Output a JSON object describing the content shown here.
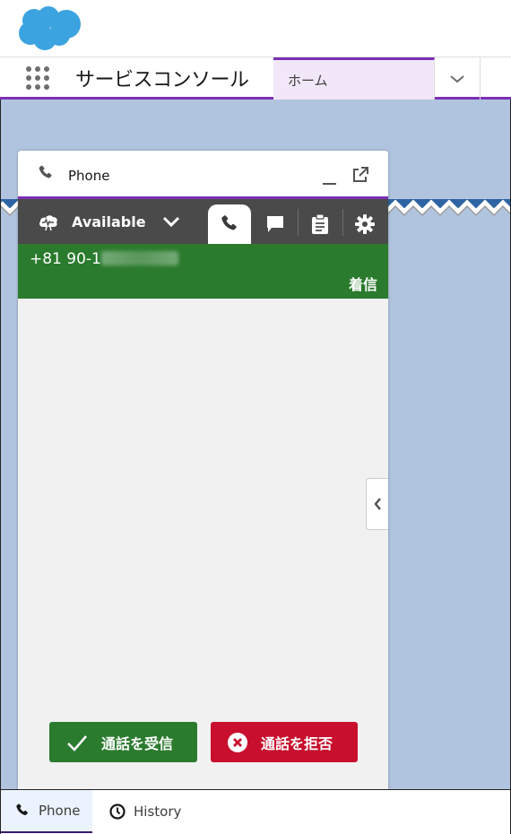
{
  "header": {
    "logo": "salesforce-cloud-logo",
    "app_launcher_icon": "app-launcher-grid-icon",
    "app_name": "サービスコンソール",
    "nav_tabs": [
      {
        "label": "ホーム",
        "active": true
      }
    ],
    "nav_more_icon": "chevron-down-icon"
  },
  "phone_panel": {
    "title": "Phone",
    "title_icon": "phone-icon",
    "minimize_icon": "minimize-icon",
    "popout_icon": "popout-icon",
    "toolbar": {
      "status_label": "Available",
      "status_icon": "cloud-status-icon",
      "status_dropdown_icon": "chevron-down-icon",
      "tabs": [
        {
          "name": "phone",
          "icon": "phone-icon",
          "active": true
        },
        {
          "name": "chat",
          "icon": "chat-icon",
          "active": false
        },
        {
          "name": "tasks",
          "icon": "clipboard-icon",
          "active": false
        },
        {
          "name": "settings",
          "icon": "gear-icon",
          "active": false
        }
      ]
    },
    "call": {
      "number_visible": "+81 90-1",
      "number_redacted": true,
      "status": "着信"
    },
    "actions": {
      "accept_label": "通話を受信",
      "reject_label": "通話を拒否"
    },
    "collapse_icon": "chevron-left-icon"
  },
  "utility_bar": {
    "items": [
      {
        "label": "Phone",
        "icon": "phone-icon",
        "active": true
      },
      {
        "label": "History",
        "icon": "clock-icon",
        "active": false
      }
    ]
  },
  "colors": {
    "brand_purple": "#7b2fb5",
    "accept_green": "#2b7b2e",
    "reject_red": "#c8102e",
    "workspace_bg": "#b1c4df",
    "toolbar_dark": "#4a4a4a",
    "salesforce_blue": "#3ba3e0"
  }
}
